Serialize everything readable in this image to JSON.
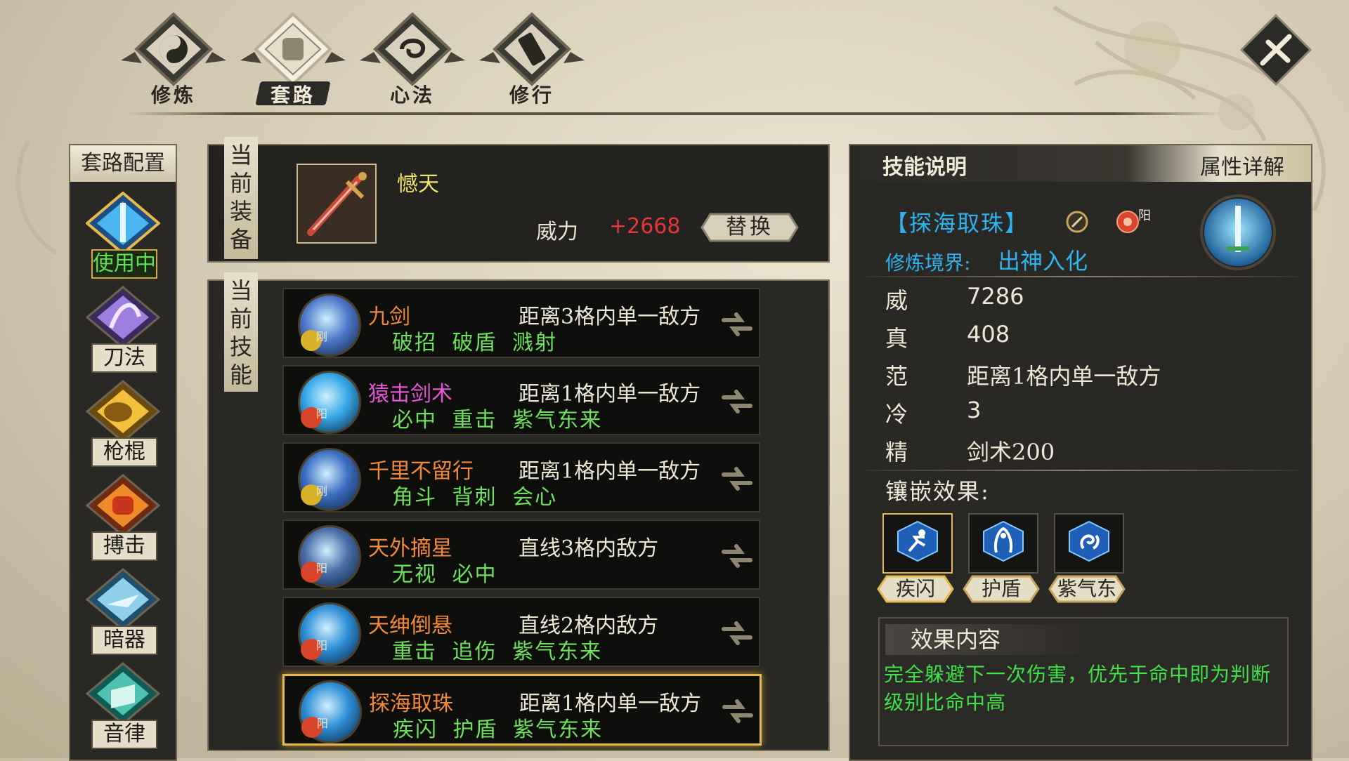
{
  "top_tabs": [
    {
      "label": "修炼",
      "active": false
    },
    {
      "label": "套路",
      "active": true
    },
    {
      "label": "心法",
      "active": false
    },
    {
      "label": "修行",
      "active": false
    }
  ],
  "sidebar": {
    "title": "套路配置",
    "items": [
      {
        "label": "使用中",
        "icon": "sword-icon",
        "active": true
      },
      {
        "label": "刀法",
        "icon": "blade-icon",
        "active": false
      },
      {
        "label": "枪棍",
        "icon": "spear-icon",
        "active": false
      },
      {
        "label": "搏击",
        "icon": "fist-icon",
        "active": false
      },
      {
        "label": "暗器",
        "icon": "hidden-weapon-icon",
        "active": false
      },
      {
        "label": "音律",
        "icon": "music-icon",
        "active": false
      }
    ]
  },
  "equipment": {
    "title": "当前装备",
    "name": "憾天",
    "power_label": "威力",
    "power_value": "+2668",
    "replace_label": "替换"
  },
  "skills": {
    "title": "当前技能",
    "list": [
      {
        "name": "九剑",
        "name_color": "#f2883a",
        "range": "距离3格内单一敌方",
        "tags": "破招 破盾 溅射",
        "badge": "刚",
        "badge_color": "#d9b22a",
        "icon_color": "#4f79c9",
        "selected": false
      },
      {
        "name": "猿击剑术",
        "name_color": "#e356d4",
        "range": "距离1格内单一敌方",
        "tags": "必中 重击 紫气东来",
        "badge": "阳",
        "badge_color": "#d9452a",
        "icon_color": "#35a8e6",
        "selected": false
      },
      {
        "name": "千里不留行",
        "name_color": "#f2883a",
        "range": "距离1格内单一敌方",
        "tags": "角斗 背刺 会心",
        "badge": "刚",
        "badge_color": "#d9b22a",
        "icon_color": "#3c6fc2",
        "selected": false
      },
      {
        "name": "天外摘星",
        "name_color": "#f2883a",
        "range": "直线3格内敌方",
        "tags": "无视 必中",
        "badge": "阳",
        "badge_color": "#d9452a",
        "icon_color": "#4a6ea8",
        "selected": false
      },
      {
        "name": "天绅倒悬",
        "name_color": "#f2883a",
        "range": "直线2格内敌方",
        "tags": "重击 追伤 紫气东来",
        "badge": "阳",
        "badge_color": "#d9452a",
        "icon_color": "#2f8fd6",
        "selected": false
      },
      {
        "name": "探海取珠",
        "name_color": "#f2883a",
        "range": "距离1格内单一敌方",
        "tags": "疾闪 护盾 紫气东来",
        "badge": "阳",
        "badge_color": "#d9452a",
        "icon_color": "#2f8fd6",
        "selected": true
      }
    ]
  },
  "detail": {
    "tab_active": "技能说明",
    "tab_other": "属性详解",
    "skill_name": "【探海取珠】",
    "badge_text": "阳",
    "realm_label": "修炼境界:",
    "realm_value": "出神入化",
    "stats": [
      {
        "label": "威",
        "value": "7286"
      },
      {
        "label": "真",
        "value": "408"
      },
      {
        "label": "范",
        "value": "距离1格内单一敌方"
      },
      {
        "label": "冷",
        "value": "3"
      },
      {
        "label": "精",
        "value": "剑术200"
      }
    ],
    "inlay_label": "镶嵌效果:",
    "inlays": [
      {
        "label": "疾闪",
        "icon": "dash-icon",
        "selected": true
      },
      {
        "label": "护盾",
        "icon": "shield-icon",
        "selected": false
      },
      {
        "label": "紫气东来",
        "icon": "purple-aura-icon",
        "selected": false
      }
    ],
    "effect_title": "效果内容",
    "effect_text": "完全躲避下一次伤害，优先于命中即为判断级别比命中高"
  },
  "colors": {
    "accent_gold": "#e7b84b",
    "skill_green": "#6ee05d",
    "detail_blue": "#2fb3ee",
    "power_red": "#e43838"
  }
}
